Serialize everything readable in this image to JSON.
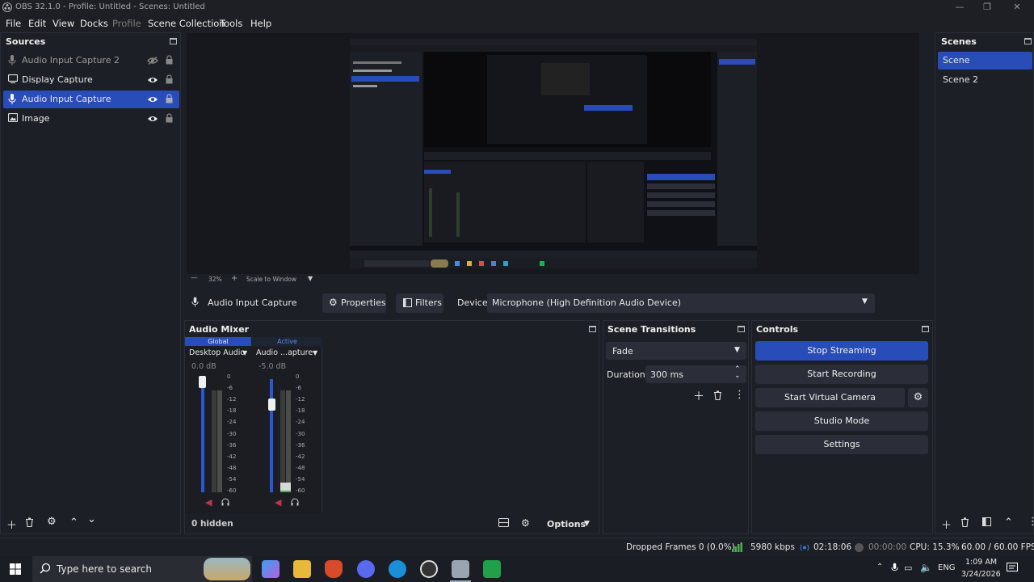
{
  "window": {
    "title": "OBS 32.1.0 - Profile: Untitled - Scenes: Untitled"
  },
  "menu": [
    "File",
    "Edit",
    "View",
    "Docks",
    "Profile",
    "Scene Collection",
    "Tools",
    "Help"
  ],
  "sources": {
    "title": "Sources",
    "items": [
      {
        "label": "Audio Input Capture 2",
        "type": "mic",
        "visible": false,
        "selected": false
      },
      {
        "label": "Display Capture",
        "type": "display",
        "visible": true,
        "selected": false
      },
      {
        "label": "Audio Input Capture",
        "type": "mic",
        "visible": true,
        "selected": true
      },
      {
        "label": "Image",
        "type": "image",
        "visible": true,
        "selected": false
      }
    ]
  },
  "scenes": {
    "title": "Scenes",
    "items": [
      "Scene",
      "Scene 2"
    ],
    "selected": "Scene"
  },
  "preview": {
    "zoom": "32%",
    "scale_mode": "Scale to Window"
  },
  "property_bar": {
    "source_name": "Audio Input Capture",
    "properties_label": "Properties",
    "filters_label": "Filters",
    "device_label": "Device",
    "device_value": "Microphone (High Definition Audio Device)"
  },
  "audio_mixer": {
    "title": "Audio Mixer",
    "tab_global": "Global",
    "tab_active": "Active",
    "channels": [
      {
        "name": "Desktop Audio",
        "db": "0.0 dB",
        "fader_level": 1.0
      },
      {
        "name": "Audio ...apture",
        "db": "-5.0 dB",
        "fader_level": 0.91
      }
    ],
    "scale": [
      "0",
      "-6",
      "-12",
      "-18",
      "-24",
      "-30",
      "-36",
      "-42",
      "-48",
      "-54",
      "-60"
    ],
    "hidden_count": "0 hidden",
    "options_label": "Options"
  },
  "scene_transitions": {
    "title": "Scene Transitions",
    "transition": "Fade",
    "duration_label": "Duration",
    "duration_value": "300 ms"
  },
  "controls": {
    "title": "Controls",
    "buttons": [
      "Stop Streaming",
      "Start Recording",
      "Start Virtual Camera",
      "Studio Mode",
      "Settings"
    ]
  },
  "status": {
    "dropped_frames": "Dropped Frames 0 (0.0%)",
    "bitrate": "5980 kbps",
    "stream_time": "02:18:06",
    "record_time": "00:00:00",
    "cpu": "CPU: 15.3%",
    "fps": "60.00 / 60.00 FPS"
  },
  "taskbar": {
    "search_placeholder": "Type here to search",
    "language": "ENG",
    "time": "1:09 AM",
    "date": "3/24/2026"
  },
  "colors": {
    "accent": "#284cb8",
    "panel": "#1d1f26",
    "control": "#2b2e38",
    "meter_green": "#4caf50"
  }
}
